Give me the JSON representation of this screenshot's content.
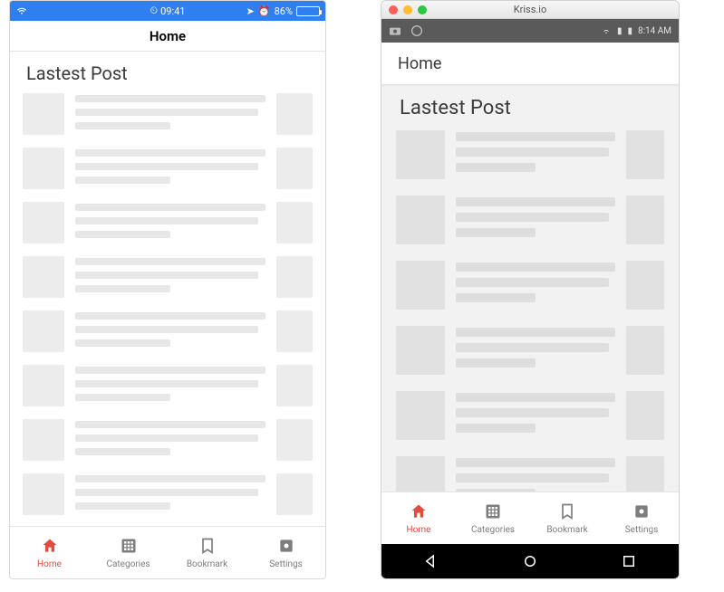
{
  "ios": {
    "status": {
      "time": "09:41",
      "battery_pct": "86%",
      "battery_fill_width": "86%"
    },
    "nav_title": "Home",
    "section_title": "Lastest Post"
  },
  "mac_window_title": "Kriss.io",
  "android": {
    "status_time": "8:14 AM",
    "nav_title": "Home",
    "section_title": "Lastest Post"
  },
  "tabs": [
    {
      "label": "Home",
      "icon": "home-icon",
      "active": true
    },
    {
      "label": "Categories",
      "icon": "grid-icon",
      "active": false
    },
    {
      "label": "Bookmark",
      "icon": "bookmark-icon",
      "active": false
    },
    {
      "label": "Settings",
      "icon": "gear-icon",
      "active": false
    }
  ],
  "colors": {
    "accent": "#e34b3e",
    "ios_statusbar": "#2f7ff0",
    "skeleton": "#e7e7e7"
  }
}
